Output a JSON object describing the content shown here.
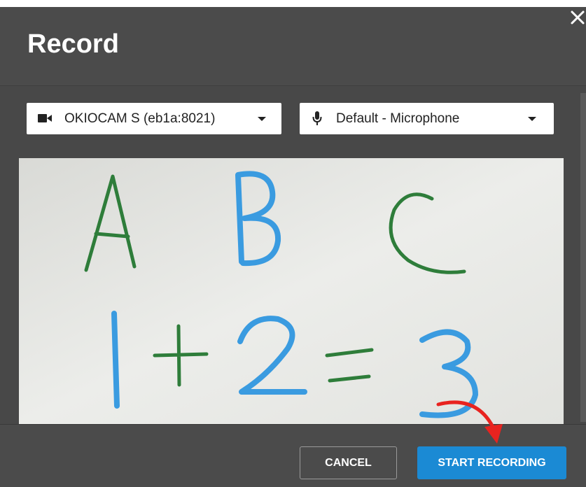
{
  "dialog": {
    "title": "Record",
    "close_icon": "close-icon"
  },
  "camera_select": {
    "icon": "video-camera-icon",
    "value": "OKIOCAM S (eb1a:8021)"
  },
  "microphone_select": {
    "icon": "microphone-icon",
    "value": "Default - Microphone"
  },
  "preview": {
    "description_icon": "camera-preview",
    "content": "whiteboard with handwritten letters and equation"
  },
  "footer": {
    "cancel_label": "CANCEL",
    "start_label": "START RECORDING"
  },
  "colors": {
    "dialog_bg": "#4b4b4b",
    "primary": "#1b8ad4",
    "annotation_arrow": "#e8231f",
    "marker_green": "#2e7d3a",
    "marker_blue": "#3a9be0"
  }
}
